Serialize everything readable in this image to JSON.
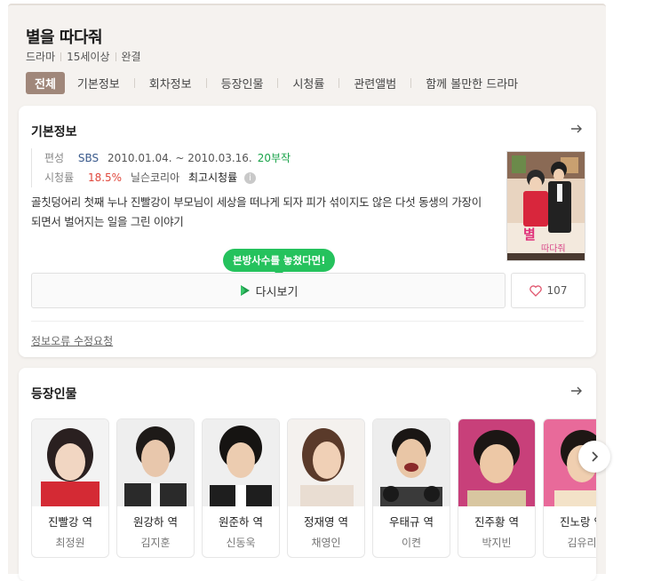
{
  "header": {
    "title": "별을 따다줘",
    "meta": [
      "드라마",
      "15세이상",
      "완결"
    ]
  },
  "tabs": [
    "전체",
    "기본정보",
    "회차정보",
    "등장인물",
    "시청률",
    "관련앨범",
    "함께 볼만한 드라마"
  ],
  "basic_info": {
    "section_title": "기본정보",
    "broadcast_label": "편성",
    "channel": "SBS",
    "period": "2010.01.04. ~ 2010.03.16.",
    "episodes": "20부작",
    "rating_label": "시청률",
    "rating_value": "18.5%",
    "rating_source": "닐슨코리아",
    "rating_note": "최고시청률",
    "description": "골칫덩어리 첫째 누나 진빨강이 부모님이 세상을 떠나게 되자 피가 섞이지도 않은 다섯 동생의 가장이 되면서 벌어지는 일을 그린 이야기",
    "tooltip": "본방사수를 놓쳤다면!",
    "replay_label": "다시보기",
    "like_count": "107",
    "report_link": "정보오류 수정요청"
  },
  "cast": {
    "section_title": "등장인물",
    "people": [
      {
        "role": "진빨강 역",
        "actor": "최정원"
      },
      {
        "role": "원강하 역",
        "actor": "김지훈"
      },
      {
        "role": "원준하 역",
        "actor": "신동욱"
      },
      {
        "role": "정재영 역",
        "actor": "채영인"
      },
      {
        "role": "우태규 역",
        "actor": "이켠"
      },
      {
        "role": "진주황 역",
        "actor": "박지빈"
      },
      {
        "role": "진노랑 역",
        "actor": "김유리"
      }
    ]
  },
  "colors": {
    "active_tab": "#a0877a",
    "tooltip": "#25c25d",
    "rating": "#e0473c",
    "episodes": "#1aa34a"
  }
}
